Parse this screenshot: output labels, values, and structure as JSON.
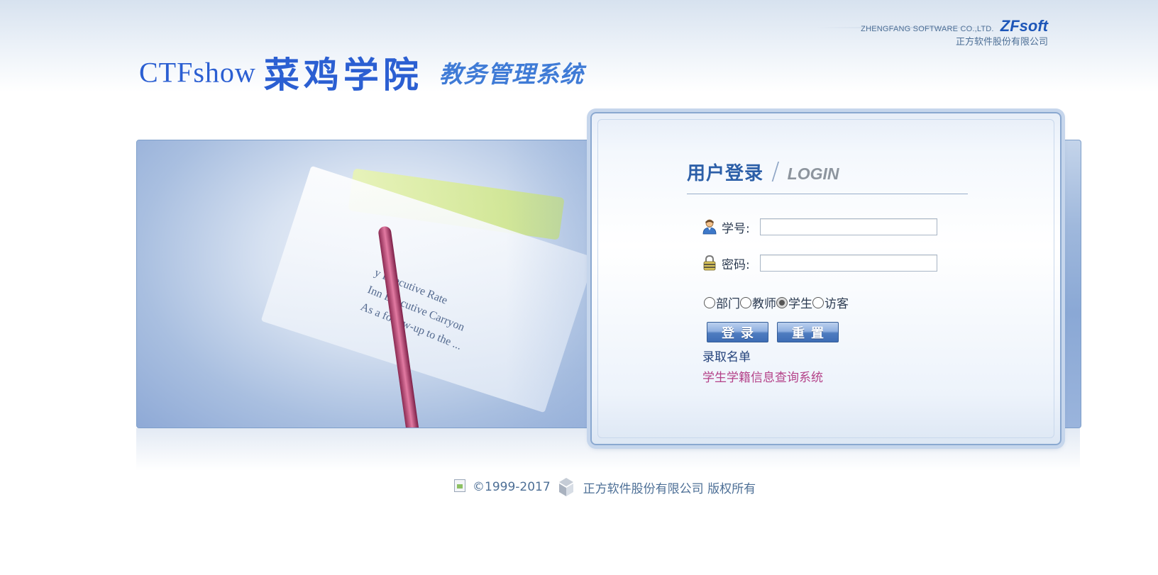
{
  "vendor": {
    "english_name": "ZHENGFANG SOFTWARE CO.,LTD.",
    "brand": "ZFsoft",
    "chinese_name": "正方软件股份有限公司"
  },
  "site_logo": {
    "prefix": "CTFshow",
    "school": "菜鸡学院",
    "system": "教务管理系统"
  },
  "banner": {
    "photo_text": [
      "y Executive Rate",
      "Inn  Executive Carryon",
      "As a follow-up to the ..."
    ]
  },
  "login": {
    "title_cn": "用户登录",
    "title_en": "LOGIN",
    "username": {
      "label": "学号:",
      "value": ""
    },
    "password": {
      "label": "密码:",
      "value": ""
    },
    "roles": [
      {
        "label": "部门",
        "checked": false
      },
      {
        "label": "教师",
        "checked": false
      },
      {
        "label": "学生",
        "checked": true
      },
      {
        "label": "访客",
        "checked": false
      }
    ],
    "login_button": "登录",
    "reset_button": "重置",
    "link_admission": "录取名单",
    "link_status_query": "学生学籍信息查询系统"
  },
  "footer": {
    "copyright": "©1999-2017",
    "company": "正方软件股份有限公司 版权所有"
  },
  "colors": {
    "accent": "#2b5fd2",
    "panel_border": "#8aa8d0",
    "link_secondary": "#b44289"
  }
}
